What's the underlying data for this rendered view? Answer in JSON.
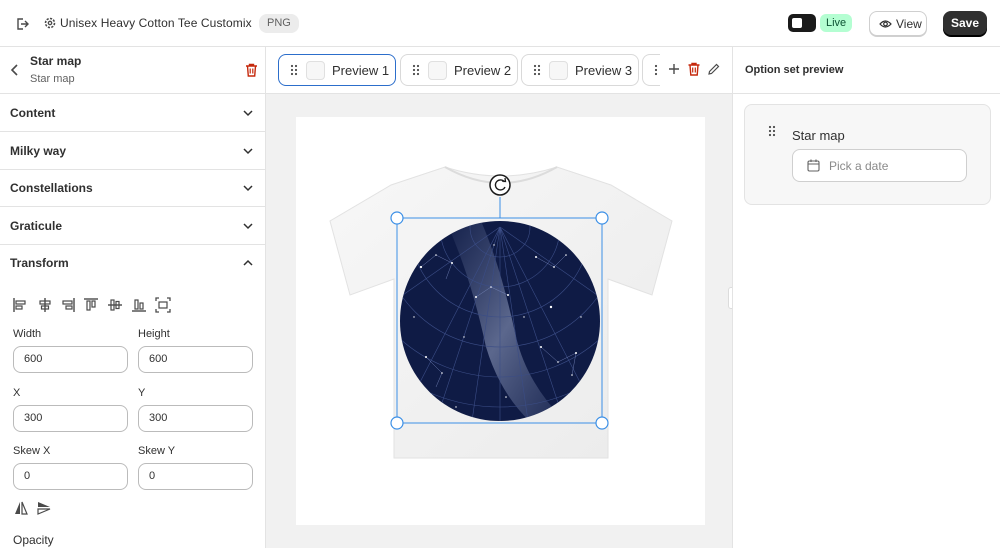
{
  "topbar": {
    "title": "Unisex Heavy Cotton Tee Customix",
    "format_badge": "PNG",
    "live_label": "Live",
    "view_label": "View",
    "save_label": "Save"
  },
  "left_panel": {
    "layer_title": "Star map",
    "layer_subtitle": "Star map",
    "sections": [
      {
        "label": "Content",
        "state": "collapsed"
      },
      {
        "label": "Milky way",
        "state": "collapsed"
      },
      {
        "label": "Constellations",
        "state": "collapsed"
      },
      {
        "label": "Graticule",
        "state": "collapsed"
      },
      {
        "label": "Transform",
        "state": "expanded"
      }
    ],
    "transform": {
      "align_icons": [
        "align-left-icon",
        "align-center-horizontal-icon",
        "align-right-icon",
        "align-top-icon",
        "align-center-vertical-icon",
        "align-bottom-icon",
        "fit-to-canvas-icon"
      ],
      "width_label": "Width",
      "width_value": "600",
      "height_label": "Height",
      "height_value": "600",
      "x_label": "X",
      "x_value": "300",
      "y_label": "Y",
      "y_value": "300",
      "skew_x_label": "Skew X",
      "skew_x_value": "0",
      "skew_y_label": "Skew Y",
      "skew_y_value": "0",
      "opacity_label": "Opacity"
    }
  },
  "tabs": [
    {
      "label": "Preview 1",
      "active": true
    },
    {
      "label": "Preview 2",
      "active": false
    },
    {
      "label": "Preview 3",
      "active": false
    }
  ],
  "right_panel": {
    "title": "Option set preview",
    "option_label": "Star map",
    "date_placeholder": "Pick a date"
  },
  "colors": {
    "accent": "#2c6ecb",
    "star_map_background": "#0f1b45",
    "danger": "#c5280c",
    "live_badge": "#b4fed2"
  }
}
